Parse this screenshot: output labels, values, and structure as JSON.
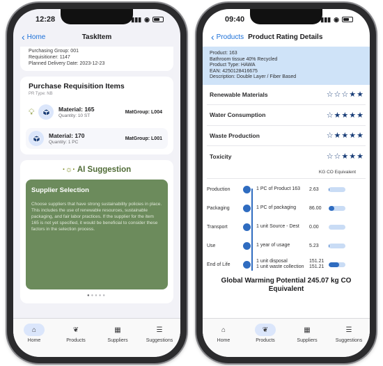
{
  "left_screen": {
    "status": {
      "time": "12:28"
    },
    "nav": {
      "back_label": "Home",
      "title": "TaskItem"
    },
    "info": {
      "purchasing_group": "Purchasing Group: 001",
      "requisitioner": "Requisitioner: 1147",
      "planned_delivery": "Planned Delivery Date: 2023-12-23"
    },
    "requisition": {
      "title": "Purchase Requisition Items",
      "pr_type": "PR Type: NB",
      "items": [
        {
          "material": "Material: 165",
          "quantity": "Quantity: 10 ST",
          "matgroup": "MatGroup: L004"
        },
        {
          "material": "Material: 170",
          "quantity": "Quantity: 1 PC",
          "matgroup": "MatGroup: L001"
        }
      ]
    },
    "ai": {
      "title": "AI Suggestion",
      "card_title": "Supplier Selection",
      "card_text": "Choose suppliers that have strong sustainability policies in place. This includes the use of renewable resources, sustainable packaging, and fair labor practices. If the supplier for the item 165 is not yet specified, it would be beneficial to consider these factors in the selection process."
    },
    "tabs": [
      {
        "label": "Home",
        "icon": "home-icon",
        "active": true
      },
      {
        "label": "Products",
        "icon": "leaf-icon",
        "active": false
      },
      {
        "label": "Suppliers",
        "icon": "building-icon",
        "active": false
      },
      {
        "label": "Suggestions",
        "icon": "list-icon",
        "active": false
      }
    ]
  },
  "right_screen": {
    "status": {
      "time": "09:40"
    },
    "nav": {
      "back_label": "Products",
      "title": "Product Rating Details"
    },
    "product": {
      "product": "Product: 163",
      "name": "Bathroom tissue 40% Recycled",
      "type": "Product Type: HAWA",
      "ean": "EAN: 4250128416675",
      "description": "Description: Double Layer / Fiber Based"
    },
    "ratings": [
      {
        "name": "Renewable Materials",
        "stars": "☆☆☆★★"
      },
      {
        "name": "Water Consumption",
        "stars": "☆★★★★"
      },
      {
        "name": "Waste Production",
        "stars": "☆★★★★"
      },
      {
        "name": "Toxicity",
        "stars": "☆☆★★★"
      }
    ],
    "unit_header": "KG CO Equivalent",
    "lifecycle": [
      {
        "stage": "Production",
        "desc": "1 PC of Product 163",
        "desc2": "",
        "value": "2.63",
        "fill": 0.02
      },
      {
        "stage": "Packaging",
        "desc": "1 PC of packaging",
        "desc2": "",
        "value": "86.00",
        "fill": 0.35
      },
      {
        "stage": "Transport",
        "desc": "1 unit Source - Dest",
        "desc2": "",
        "value": "0.00",
        "fill": 0.0
      },
      {
        "stage": "Use",
        "desc": "1 year of usage",
        "desc2": "",
        "value": "5.23",
        "fill": 0.03
      },
      {
        "stage": "End of Life",
        "desc": "1 unit disposal",
        "desc2": "1 unit waste collection",
        "value": "151.21",
        "value2": "151.21",
        "fill": 0.62
      }
    ],
    "gwp": "Global Warming Potential 245.07 kg CO Equivalent",
    "tabs": [
      {
        "label": "Home",
        "icon": "home-icon",
        "active": false
      },
      {
        "label": "Products",
        "icon": "leaf-icon",
        "active": true
      },
      {
        "label": "Suppliers",
        "icon": "building-icon",
        "active": false
      },
      {
        "label": "Suggestions",
        "icon": "list-icon",
        "active": false
      }
    ]
  }
}
